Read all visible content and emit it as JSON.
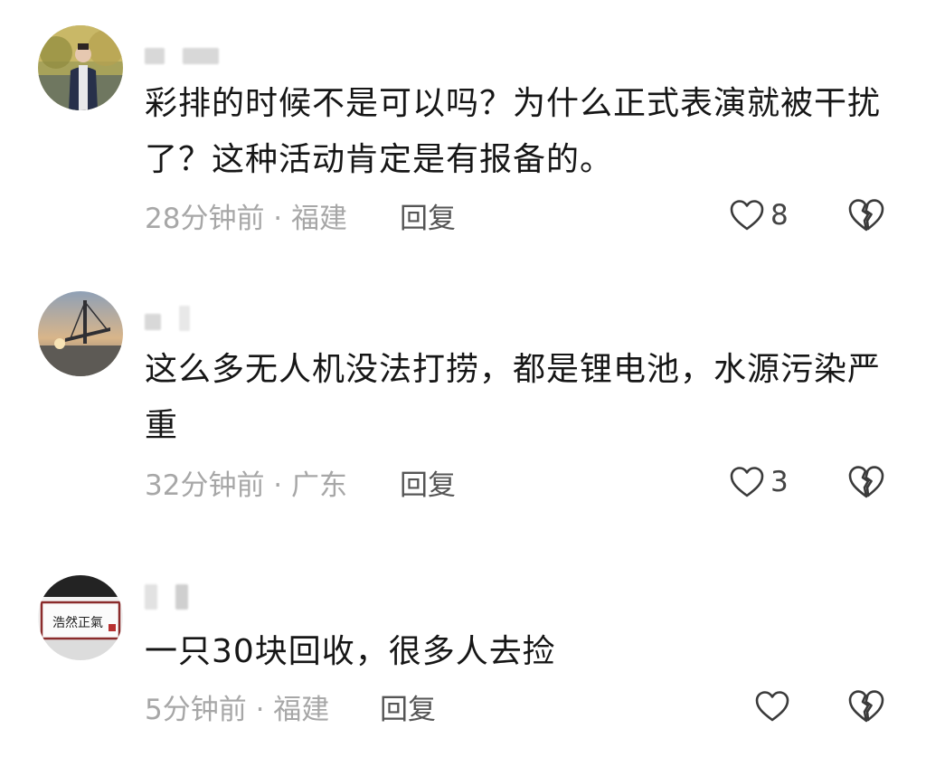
{
  "comments": [
    {
      "text": "彩排的时候不是可以吗？为什么正式表演就被干扰了？这种活动肯定是有报备的。",
      "meta": "28分钟前 · 福建",
      "reply": "回复",
      "likes": "8",
      "avatar": "person-photo"
    },
    {
      "text": "这么多无人机没法打捞，都是锂电池，水源污染严重",
      "meta": "32分钟前 · 广东",
      "reply": "回复",
      "likes": "3",
      "avatar": "bridge-sunset-photo"
    },
    {
      "text": "一只30块回收，很多人去捡",
      "meta": "5分钟前 · 福建",
      "reply": "回复",
      "likes": "",
      "avatar": "calligraphy-frame",
      "avatar_text": "浩然正氣"
    }
  ],
  "icons": {
    "like": "heart-outline-icon",
    "dislike": "broken-heart-icon"
  },
  "colors": {
    "text": "#161616",
    "meta": "#a7a7a7",
    "reply": "#555555",
    "icon": "#3a3a3a"
  }
}
